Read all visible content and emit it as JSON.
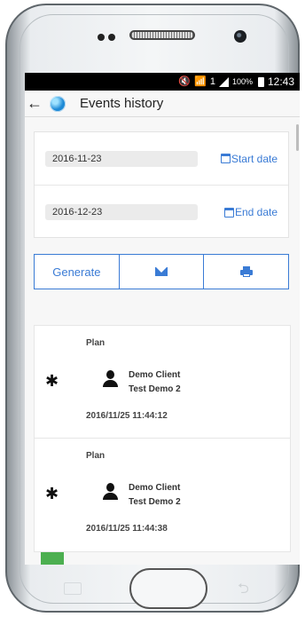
{
  "status_bar": {
    "icons": [
      "mute-icon",
      "wifi-icon",
      "sim-icon",
      "signal-icon"
    ],
    "sim_label": "1",
    "battery_percent": "100%",
    "time": "12:43"
  },
  "app_bar": {
    "back_glyph": "←",
    "title": "Events history"
  },
  "filters": {
    "start_date_value": "2016-11-23",
    "start_date_label": "Start date",
    "end_date_value": "2016-12-23",
    "end_date_label": "End date"
  },
  "actions": {
    "generate_label": "Generate"
  },
  "events": [
    {
      "type": "Plan",
      "icon": "bluetooth-icon",
      "client_line1": "Demo Client",
      "client_line2": "Test Demo 2",
      "timestamp": "2016/11/25 11:44:12"
    },
    {
      "type": "Plan",
      "icon": "bluetooth-icon",
      "client_line1": "Demo Client",
      "client_line2": "Test Demo 2",
      "timestamp": "2016/11/25 11:44:38"
    }
  ],
  "colors": {
    "accent": "#3a7bd5",
    "status_green": "#4caf50"
  }
}
